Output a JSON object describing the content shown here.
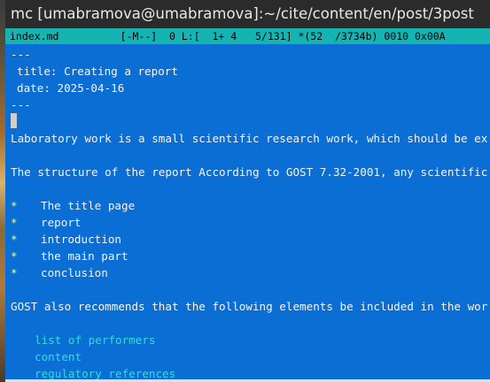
{
  "window": {
    "title": "mc [umabramova@umabramova]:~/cite/content/en/post/3post"
  },
  "status": {
    "filename": "index.md",
    "mode": "[-M--]",
    "info": "0 L:[  1+ 4   5/131] *(52  /3734b) 0010 0x00A"
  },
  "editor": {
    "front_matter_open": "---",
    "title_line": "title: Creating a report",
    "date_line": "date: 2025-04-16",
    "front_matter_close": "---",
    "para1": "Laboratory work is a small scientific research work, which should be executed",
    "para2": "The structure of the report According to GOST 7.32-2001, any scientific resear",
    "bullet_marker": "*",
    "bullets": [
      "The title page",
      "report",
      "introduction",
      "the main part",
      "conclusion"
    ],
    "para3": "GOST also recommends that the following elements be included in the work::",
    "sub_items": [
      "list of performers",
      "content",
      "regulatory references"
    ]
  }
}
